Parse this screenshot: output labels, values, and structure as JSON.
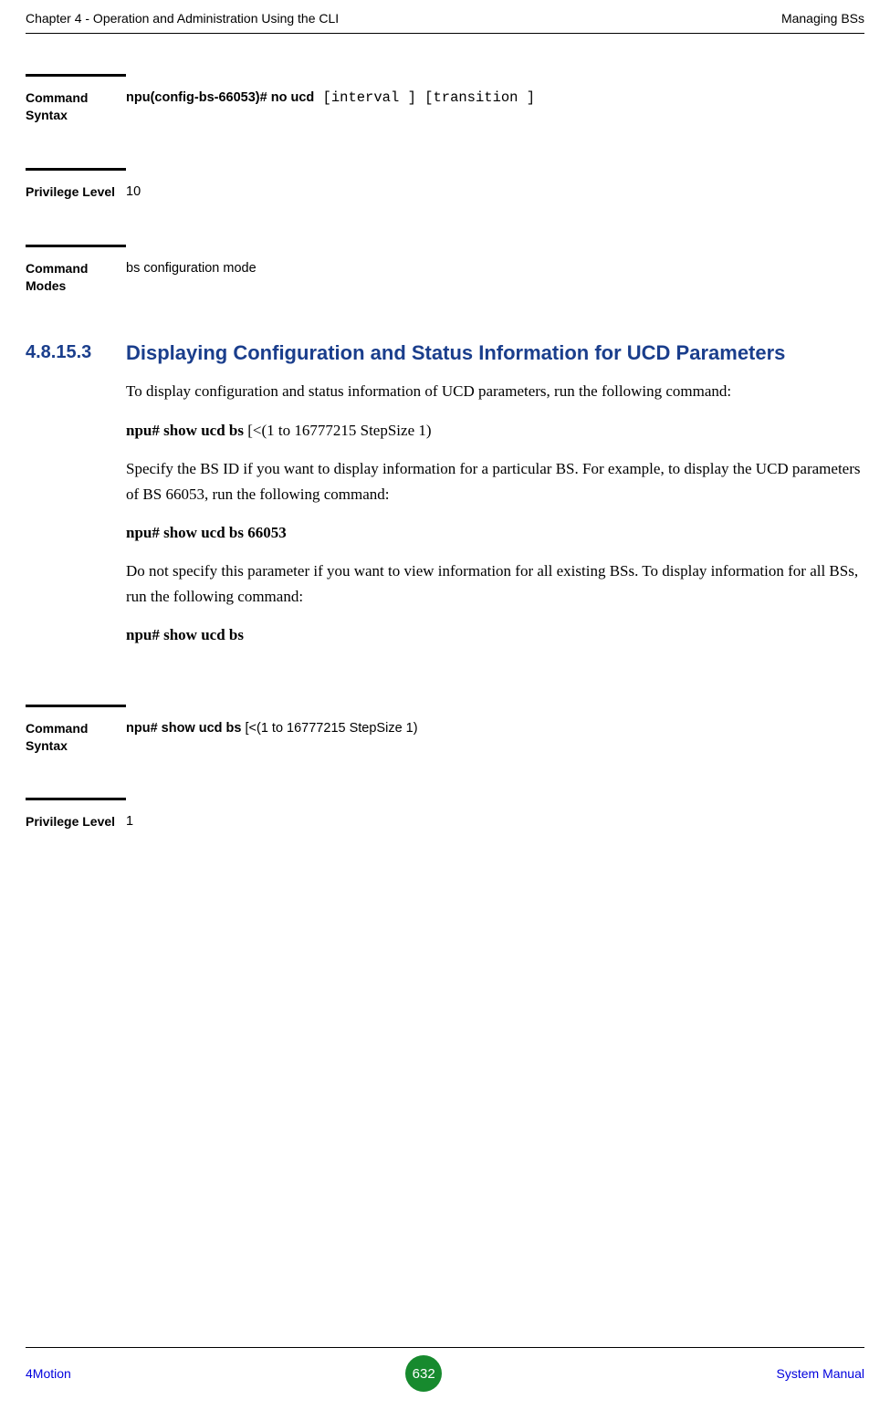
{
  "header": {
    "left": "Chapter 4 - Operation and Administration Using the CLI",
    "right": "Managing BSs"
  },
  "block1": {
    "label": "Command Syntax",
    "value_bold": "npu(config-bs-66053)# no ucd",
    "value_rest": " [interval ] [transition ]"
  },
  "block2": {
    "label": "Privilege Level",
    "value": "10"
  },
  "block3": {
    "label": "Command Modes",
    "value": "bs configuration mode"
  },
  "section": {
    "number": "4.8.15.3",
    "title": "Displaying Configuration and Status Information for UCD Parameters",
    "para1": "To display configuration and status information of UCD parameters, run the following command:",
    "cmd1_bold": "npu# show ucd bs",
    "cmd1_rest": " [<(1 to 16777215 StepSize 1)",
    "para2": "Specify the BS ID if you want to display information for a particular BS. For example, to display the UCD parameters of BS 66053, run the following command:",
    "cmd2": "npu# show ucd bs 66053",
    "para3": "Do not specify this parameter if you want to view information for all existing BSs. To display information for all BSs, run the following command:",
    "cmd3": "npu# show ucd bs"
  },
  "block4": {
    "label": "Command Syntax",
    "value_bold": "npu# show ucd bs ",
    "value_rest": "[<(1 to 16777215 StepSize 1)"
  },
  "block5": {
    "label": "Privilege Level",
    "value": "1"
  },
  "footer": {
    "left": "4Motion",
    "page": "632",
    "right": "System Manual"
  }
}
